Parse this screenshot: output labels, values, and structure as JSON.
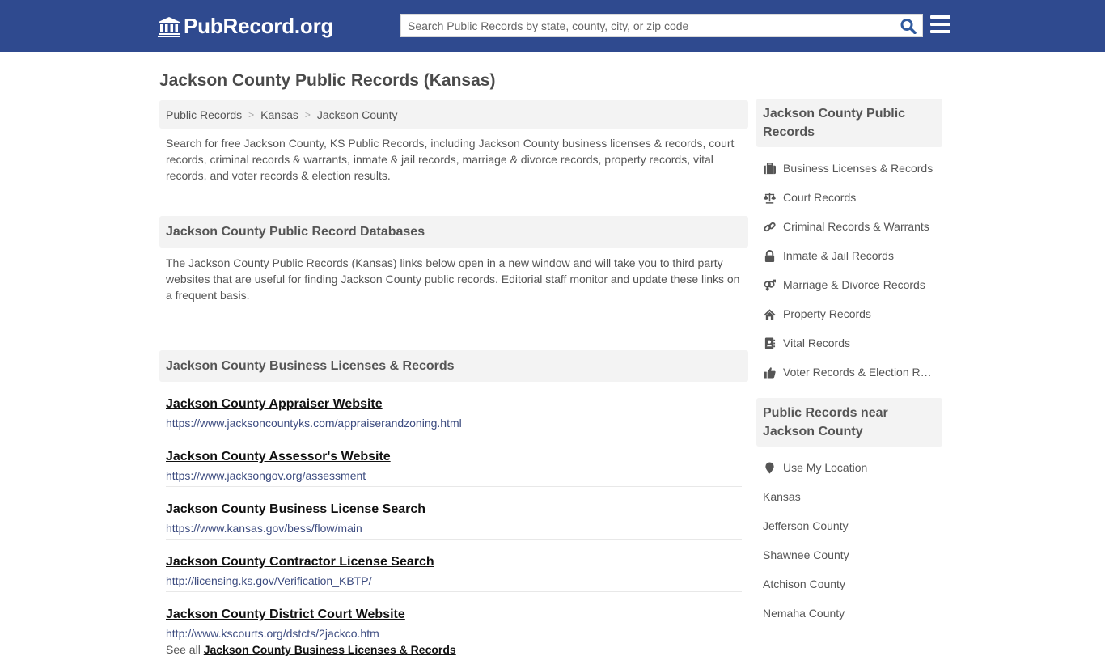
{
  "header": {
    "logo_text": "PubRecord.org",
    "search_placeholder": "Search Public Records by state, county, city, or zip code"
  },
  "page_title": "Jackson County Public Records (Kansas)",
  "breadcrumb": [
    "Public Records",
    "Kansas",
    "Jackson County"
  ],
  "intro": "Search for free Jackson County, KS Public Records, including Jackson County business licenses & records, court records, criminal records & warrants, inmate & jail records, marriage & divorce records, property records, vital records, and voter records & election results.",
  "databases": {
    "heading": "Jackson County Public Record Databases",
    "text": "The Jackson County Public Records (Kansas) links below open in a new window and will take you to third party websites that are useful for finding Jackson County public records. Editorial staff monitor and update these links on a frequent basis."
  },
  "business": {
    "heading": "Jackson County Business Licenses & Records",
    "links": [
      {
        "title": "Jackson County Appraiser Website",
        "url": "https://www.jacksoncountyks.com/appraiserandzoning.html"
      },
      {
        "title": "Jackson County Assessor's Website",
        "url": "https://www.jacksongov.org/assessment"
      },
      {
        "title": "Jackson County Business License Search",
        "url": "https://www.kansas.gov/bess/flow/main"
      },
      {
        "title": "Jackson County Contractor License Search",
        "url": "http://licensing.ks.gov/Verification_KBTP/"
      },
      {
        "title": "Jackson County District Court Website",
        "url": "http://www.kscourts.org/dstcts/2jackco.htm"
      }
    ],
    "see_all_prefix": "See all",
    "see_all_link": "Jackson County Business Licenses & Records"
  },
  "sidebar": {
    "records_heading": "Jackson County Public Records",
    "records_items": [
      {
        "label": "Business Licenses & Records",
        "icon": "briefcase-icon"
      },
      {
        "label": "Court Records",
        "icon": "balance-scale-icon"
      },
      {
        "label": "Criminal Records & Warrants",
        "icon": "link-icon"
      },
      {
        "label": "Inmate & Jail Records",
        "icon": "lock-icon"
      },
      {
        "label": "Marriage & Divorce Records",
        "icon": "venus-mars-icon"
      },
      {
        "label": "Property Records",
        "icon": "home-icon"
      },
      {
        "label": "Vital Records",
        "icon": "address-book-icon"
      },
      {
        "label": "Voter Records & Election Results",
        "icon": "thumbs-up-icon"
      }
    ],
    "near_heading": "Public Records near Jackson County",
    "use_location": "Use My Location",
    "near_items": [
      "Kansas",
      "Jefferson County",
      "Shawnee County",
      "Atchison County",
      "Nemaha County"
    ]
  }
}
